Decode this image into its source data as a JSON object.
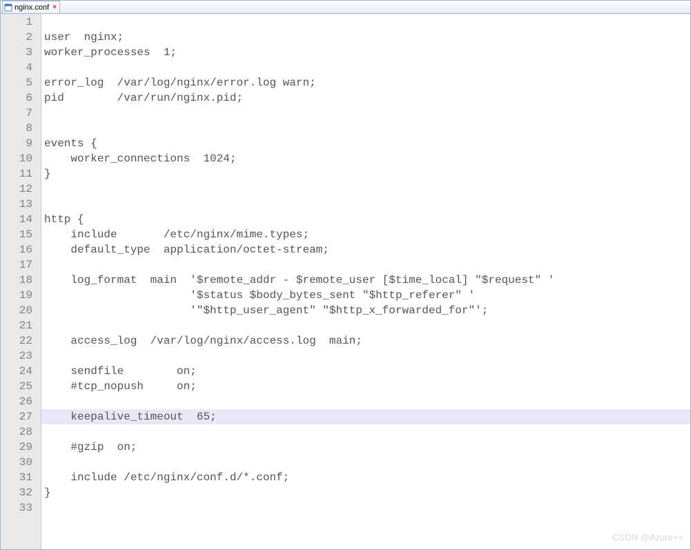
{
  "tab": {
    "filename": "nginx.conf"
  },
  "highlight_line": 27,
  "lines": [
    "",
    "user  nginx;",
    "worker_processes  1;",
    "",
    "error_log  /var/log/nginx/error.log warn;",
    "pid        /var/run/nginx.pid;",
    "",
    "",
    "events {",
    "    worker_connections  1024;",
    "}",
    "",
    "",
    "http {",
    "    include       /etc/nginx/mime.types;",
    "    default_type  application/octet-stream;",
    "",
    "    log_format  main  '$remote_addr - $remote_user [$time_local] \"$request\" '",
    "                      '$status $body_bytes_sent \"$http_referer\" '",
    "                      '\"$http_user_agent\" \"$http_x_forwarded_for\"';",
    "",
    "    access_log  /var/log/nginx/access.log  main;",
    "",
    "    sendfile        on;",
    "    #tcp_nopush     on;",
    "",
    "    keepalive_timeout  65;",
    "",
    "    #gzip  on;",
    "",
    "    include /etc/nginx/conf.d/*.conf;",
    "}",
    ""
  ],
  "watermark": "CSDN @Azure++"
}
